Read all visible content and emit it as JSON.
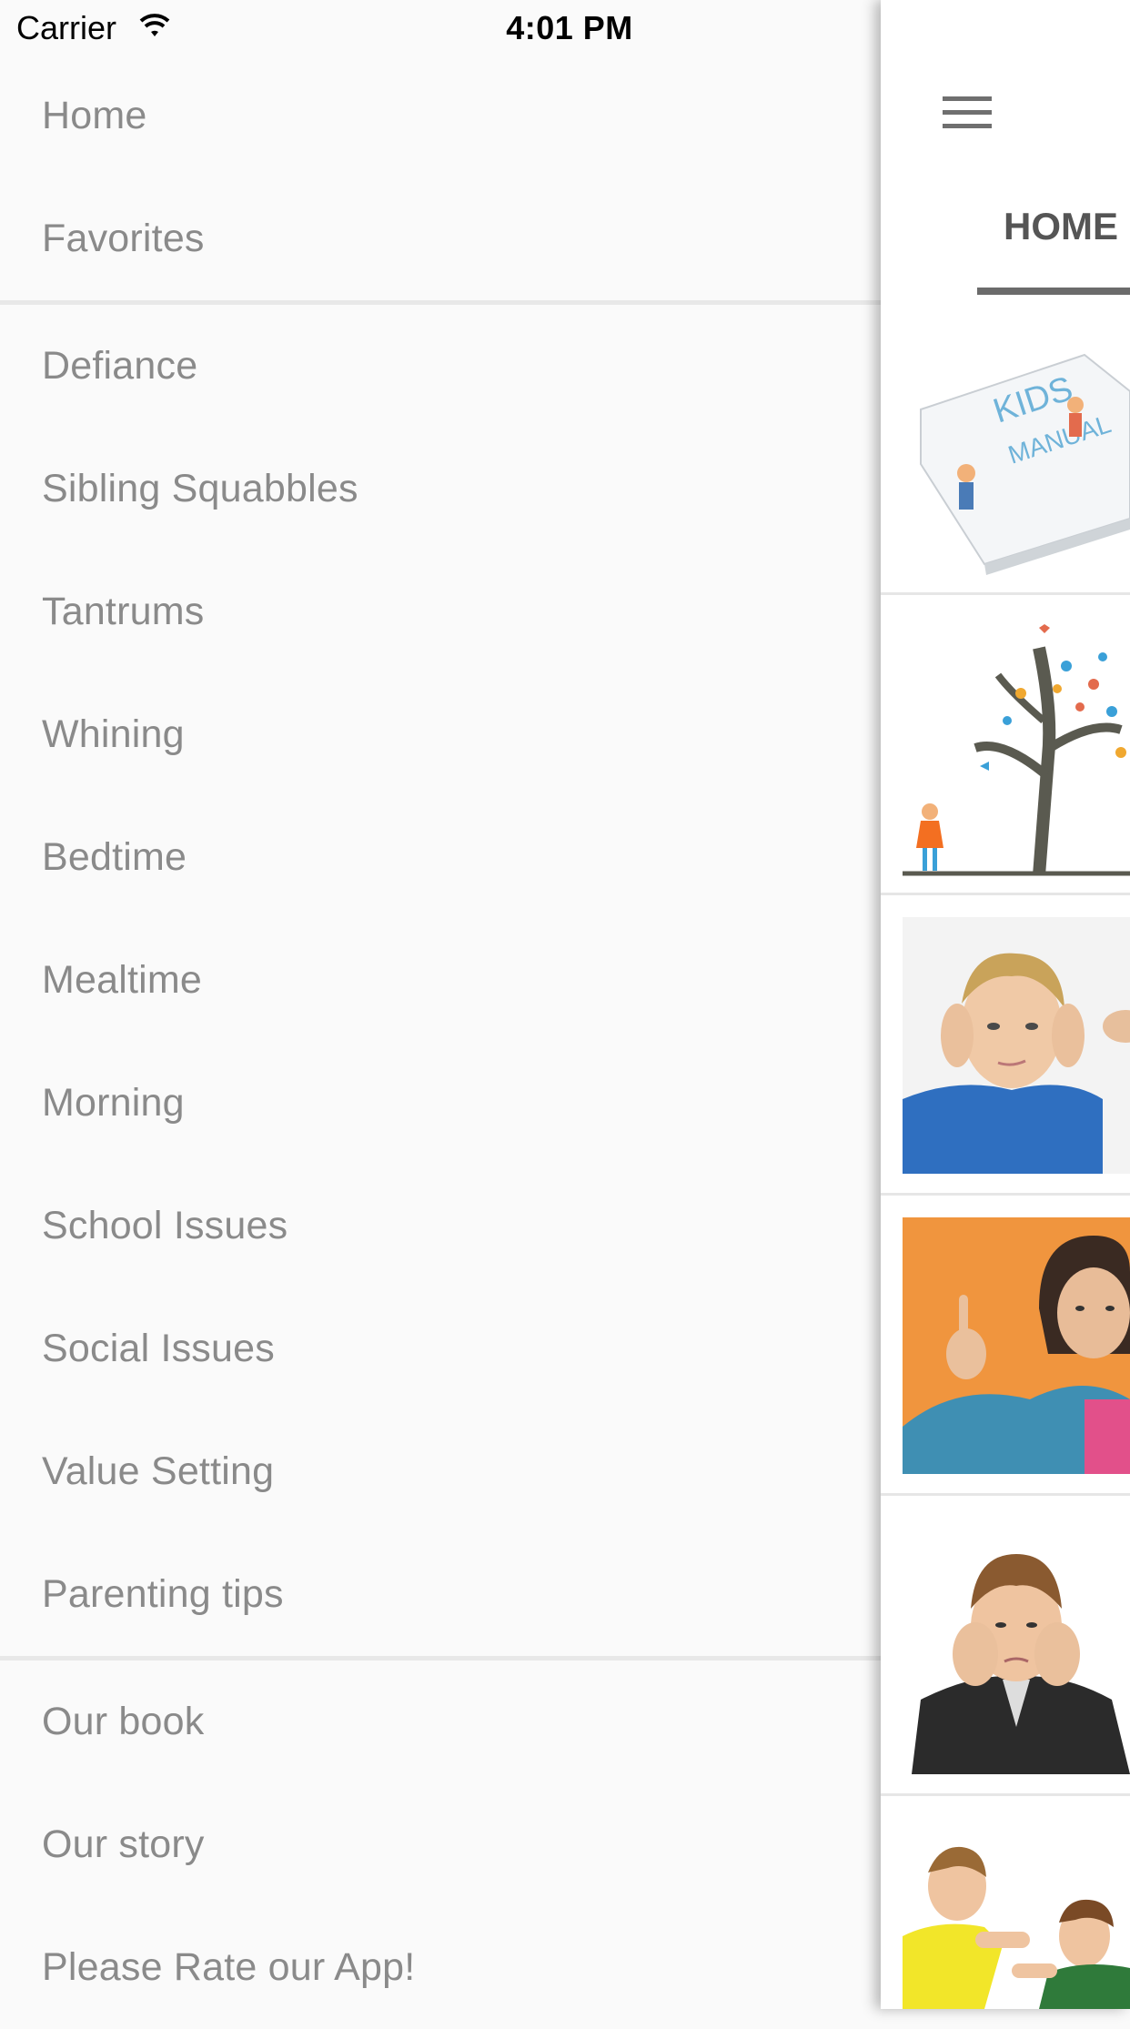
{
  "status_bar": {
    "carrier": "Carrier",
    "time": "4:01 PM"
  },
  "menu": {
    "group1": [
      "Home",
      "Favorites"
    ],
    "group2": [
      "Defiance",
      "Sibling Squabbles",
      "Tantrums",
      "Whining",
      "Bedtime",
      "Mealtime",
      "Morning",
      "School Issues",
      "Social Issues",
      "Value Setting",
      "Parenting tips"
    ],
    "group3": [
      "Our book",
      "Our story",
      "Please Rate our App!"
    ]
  },
  "main": {
    "tab_label": "HOME",
    "icons": [
      "hamburger-menu-icon"
    ],
    "colors": {
      "tab_indicator": "#6b6b6b",
      "menu_text": "#8a8a8a"
    }
  }
}
